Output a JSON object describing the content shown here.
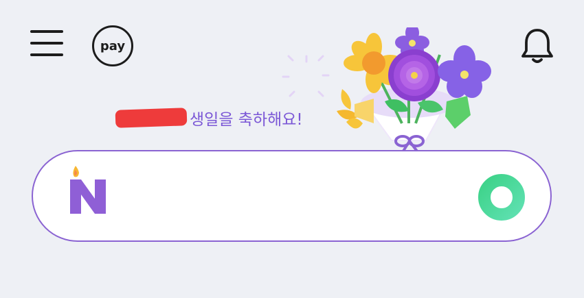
{
  "header": {
    "menu_icon": "hamburger-menu-icon",
    "pay_label": "pay",
    "notification_icon": "bell-icon"
  },
  "greeting": {
    "text": "생일을 축하해요!",
    "redaction_color": "#ee3b3b",
    "text_color": "#7b57d6"
  },
  "search": {
    "placeholder": "",
    "border_color": "#8a63d2",
    "logo_icon": "naver-n-birthday-candle-icon",
    "action_icon": "green-circle-icon"
  },
  "decoration": {
    "bouquet_icon": "flower-bouquet-icon"
  },
  "colors": {
    "background": "#eef0f5",
    "accent_purple": "#7b57d6",
    "accent_green": "#3ed38a"
  }
}
